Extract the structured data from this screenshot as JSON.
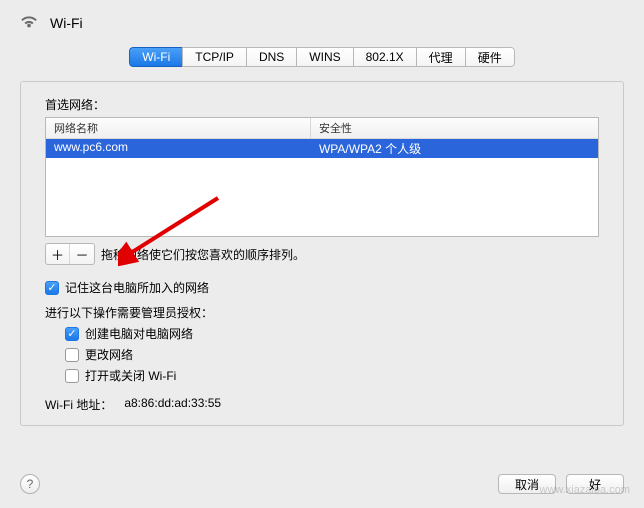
{
  "title": "Wi-Fi",
  "tabs": [
    "Wi-Fi",
    "TCP/IP",
    "DNS",
    "WINS",
    "802.1X",
    "代理",
    "硬件"
  ],
  "preferred_label": "首选网络：",
  "columns": {
    "name": "网络名称",
    "security": "安全性"
  },
  "networks": [
    {
      "name": "www.pc6.com",
      "security": "WPA/WPA2 个人级"
    }
  ],
  "drag_hint": "拖移网络使它们按您喜欢的顺序排列。",
  "remember_label": "记住这台电脑所加入的网络",
  "admin_label": "进行以下操作需要管理员授权：",
  "admin_opts": {
    "create": "创建电脑对电脑网络",
    "change": "更改网络",
    "toggle": "打开或关闭 Wi-Fi"
  },
  "addr_label": "Wi-Fi 地址：",
  "addr_value": "a8:86:dd:ad:33:55",
  "buttons": {
    "cancel": "取消",
    "ok": "好"
  },
  "plus": "＋",
  "minus": "－",
  "help": "?"
}
